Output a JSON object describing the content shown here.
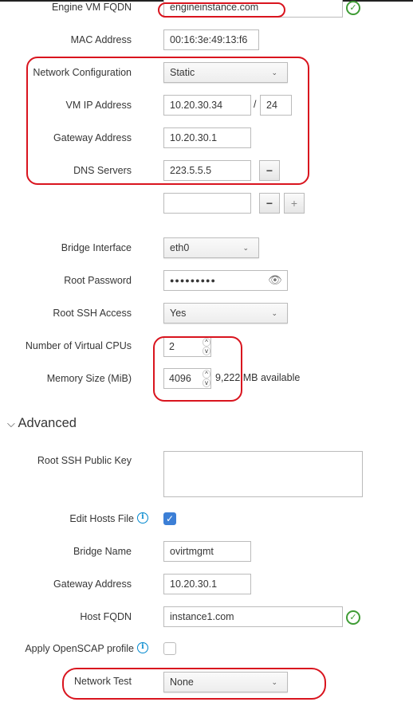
{
  "fields": {
    "engine_fqdn": {
      "label": "Engine VM FQDN",
      "value": "engineinstance.com",
      "status": "valid-check-icon"
    },
    "mac": {
      "label": "MAC Address",
      "value": "00:16:3e:49:13:f6"
    },
    "network_config": {
      "label": "Network Configuration",
      "value": "Static"
    },
    "vm_ip": {
      "label": "VM IP Address",
      "value": "10.20.30.34",
      "separator": "/",
      "prefix": "24"
    },
    "gateway": {
      "label": "Gateway Address",
      "value": "10.20.30.1"
    },
    "dns": {
      "label": "DNS Servers",
      "values": [
        "223.5.5.5",
        ""
      ],
      "remove_label": "−",
      "add_label": "+"
    },
    "bridge_interface": {
      "label": "Bridge Interface",
      "value": "eth0"
    },
    "root_password": {
      "label": "Root Password",
      "value": "●●●●●●●●●"
    },
    "root_ssh": {
      "label": "Root SSH Access",
      "value": "Yes"
    },
    "vcpus": {
      "label": "Number of Virtual CPUs",
      "value": "2"
    },
    "memory": {
      "label": "Memory Size (MiB)",
      "value": "4096",
      "available": "9,222 MB available"
    }
  },
  "advanced": {
    "title": "Advanced",
    "ssh_key": {
      "label": "Root SSH Public Key",
      "value": ""
    },
    "edit_hosts": {
      "label": "Edit Hosts File",
      "checked": true
    },
    "bridge_name": {
      "label": "Bridge Name",
      "value": "ovirtmgmt"
    },
    "gateway": {
      "label": "Gateway Address",
      "value": "10.20.30.1"
    },
    "host_fqdn": {
      "label": "Host FQDN",
      "value": "instance1.com",
      "status": "valid-check-icon"
    },
    "openscap": {
      "label": "Apply OpenSCAP profile",
      "checked": false
    },
    "network_test": {
      "label": "Network Test",
      "value": "None"
    }
  },
  "colors": {
    "annotation": "#d9141e",
    "valid": "#3f9c35",
    "checkbox": "#3c7fd6",
    "info": "#0088ce"
  }
}
